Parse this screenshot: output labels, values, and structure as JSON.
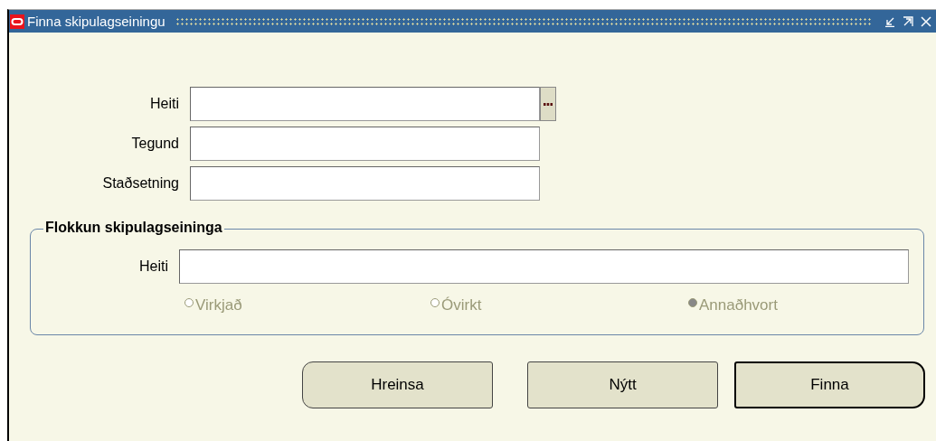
{
  "window": {
    "title": "Finna skipulagseiningu"
  },
  "fields": [
    {
      "label": "Heiti",
      "lov": true
    },
    {
      "label": "Tegund",
      "lov": false
    },
    {
      "label": "Staðsetning",
      "lov": false
    }
  ],
  "group": {
    "title": "Flokkun skipulagseininga",
    "field": {
      "label": "Heiti"
    },
    "radios": [
      {
        "label": "Virkjað",
        "selected": false,
        "disabled": true
      },
      {
        "label": "Óvirkt",
        "selected": false,
        "disabled": true
      },
      {
        "label": "Annaðhvort",
        "selected": true,
        "disabled": true
      }
    ]
  },
  "buttons": [
    {
      "label": "Hreinsa",
      "default": false
    },
    {
      "label": "Nýtt",
      "default": false
    },
    {
      "label": "Finna",
      "default": true
    }
  ]
}
